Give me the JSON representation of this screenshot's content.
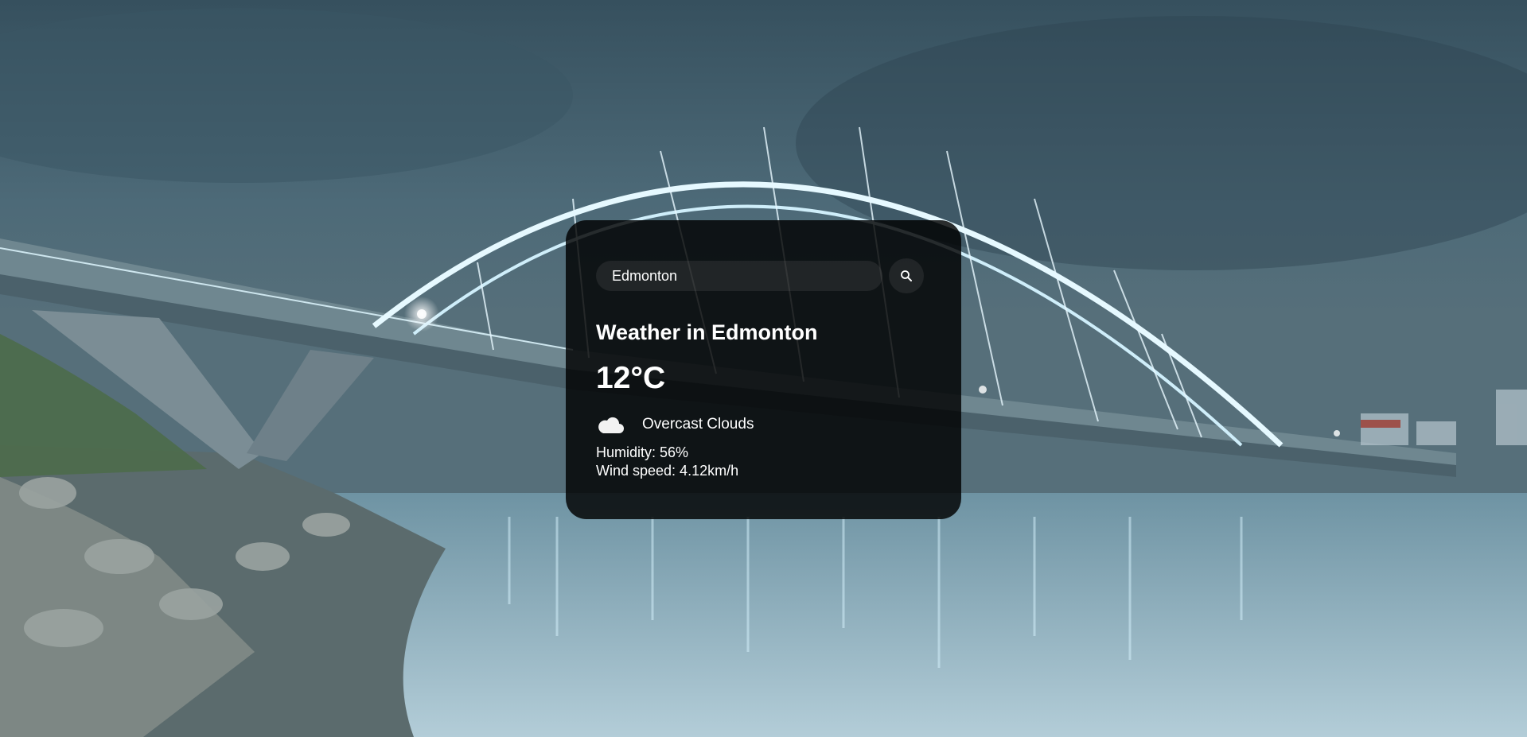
{
  "search": {
    "value": "Edmonton",
    "placeholder": "Search",
    "button_icon": "search-icon"
  },
  "weather": {
    "city_heading": "Weather in Edmonton",
    "temperature": "12°C",
    "condition_icon": "cloud-icon",
    "description": "Overcast Clouds",
    "humidity": "Humidity: 56%",
    "wind": "Wind speed: 4.12km/h"
  },
  "background": {
    "image": "bridge-night-photo"
  },
  "colors": {
    "card_bg": "#000000",
    "text": "#ffffff"
  }
}
